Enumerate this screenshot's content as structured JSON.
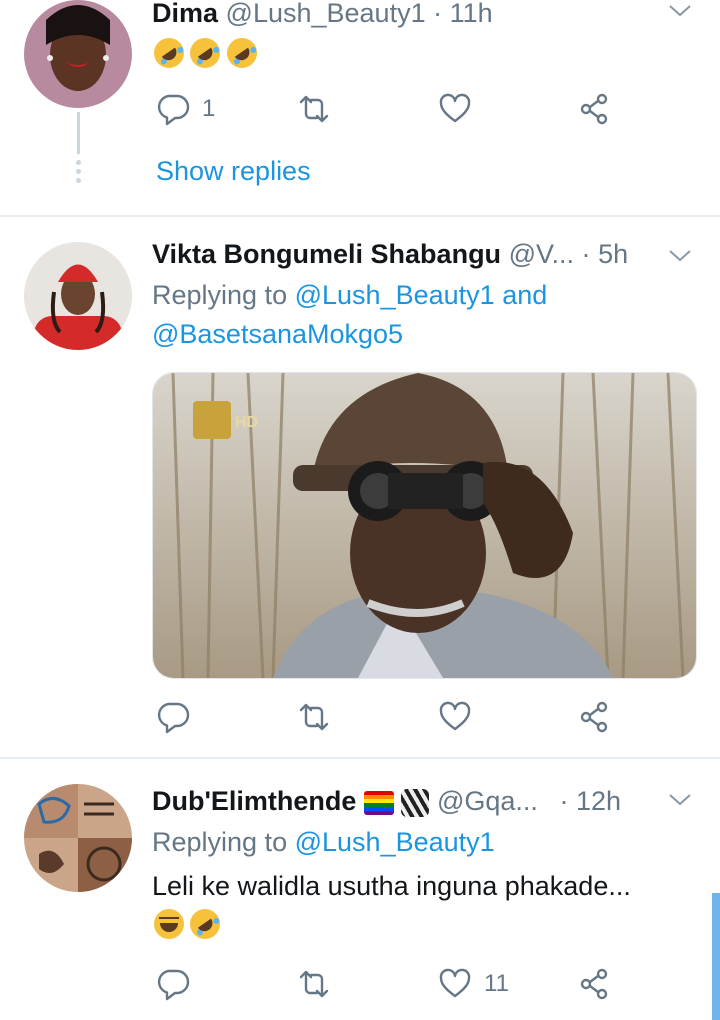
{
  "tweets": [
    {
      "name": "Dima",
      "handle": "@Lush_Beauty1",
      "dot": "·",
      "time": "11h",
      "reply_count": "1",
      "show_replies": "Show replies"
    },
    {
      "name": "Vikta Bongumeli Shabangu",
      "handle": "@V...",
      "dot": "·",
      "time": "5h",
      "replying_prefix": "Replying to",
      "mention1": "@Lush_Beauty1",
      "and": "and",
      "mention2": "@BasetsanaMokgo5",
      "media_logo": "HD"
    },
    {
      "name": "Dub'Elimthende",
      "handle": "@Gqa...",
      "dot": "·",
      "time": "12h",
      "replying_prefix": "Replying to",
      "mention1": "@Lush_Beauty1",
      "text": "Leli ke walidla usutha inguna phakade...",
      "like_count": "11"
    }
  ],
  "icons": {
    "reply": "reply-icon",
    "retweet": "retweet-icon",
    "like": "like-icon",
    "share": "share-icon",
    "chevron": "chevron-down-icon"
  },
  "colors": {
    "accent": "#1b95e0",
    "muted": "#657786",
    "divider": "#e6ecf0"
  }
}
